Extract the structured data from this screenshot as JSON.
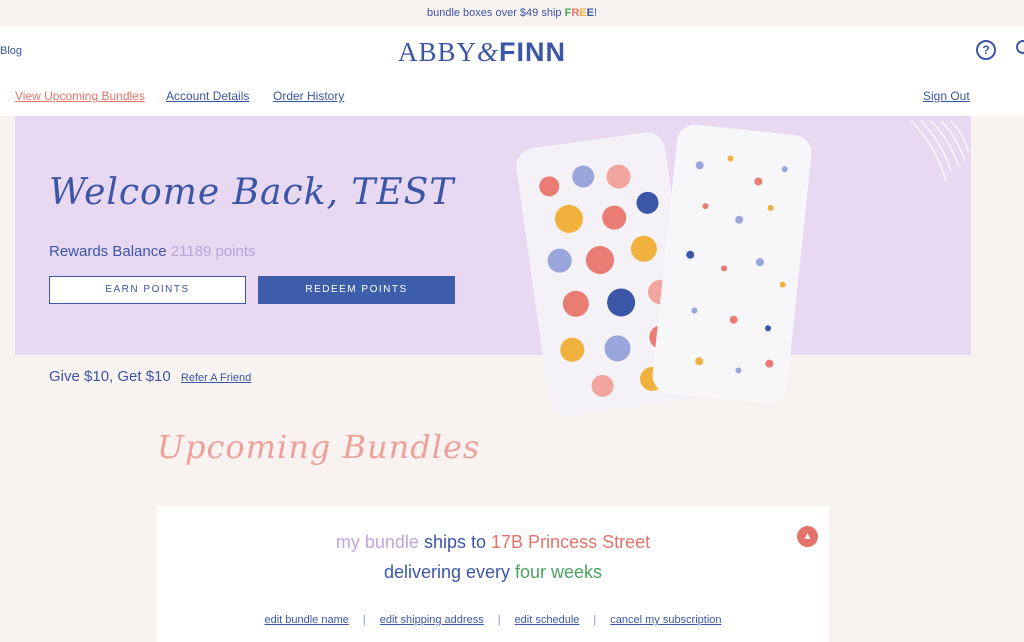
{
  "promo": {
    "text_before": "bundle boxes over $49 ship ",
    "free": [
      "F",
      "R",
      "E",
      "E"
    ],
    "free_colors": [
      "#4aa35e",
      "#e2746a",
      "#f0b23c",
      "#3b56a6"
    ],
    "text_after": "!"
  },
  "header": {
    "blog": "Blog",
    "logo_abby": "ABBY",
    "logo_amp": "&",
    "logo_finn": "FINN",
    "help_icon": "?",
    "nav": {
      "upcoming": "View Upcoming Bundles",
      "account": "Account Details",
      "orders": "Order History",
      "signout": "Sign Out"
    }
  },
  "hero": {
    "welcome": "Welcome Back, TEST",
    "rewards_label": "Rewards Balance",
    "rewards_points": "21189 points",
    "earn_button": "EARN POINTS",
    "redeem_button": "REDEEM POINTS"
  },
  "refer": {
    "text": "Give $10, Get $10",
    "link": "Refer A Friend"
  },
  "upcoming_title": "Upcoming Bundles",
  "bundle": {
    "my_bundle": "my bundle",
    "ships_to": "ships to",
    "address": "17B Princess Street",
    "delivering": "delivering every",
    "frequency": "four weeks",
    "links": {
      "edit_name": "edit bundle name",
      "edit_address": "edit shipping address",
      "edit_schedule": "edit schedule",
      "cancel": "cancel my subscription"
    }
  },
  "colors": {
    "brand": "#3b56a6",
    "accent": "#e2746a",
    "hero_bg": "#e8d8f1",
    "page_bg": "#f8f3f1"
  }
}
